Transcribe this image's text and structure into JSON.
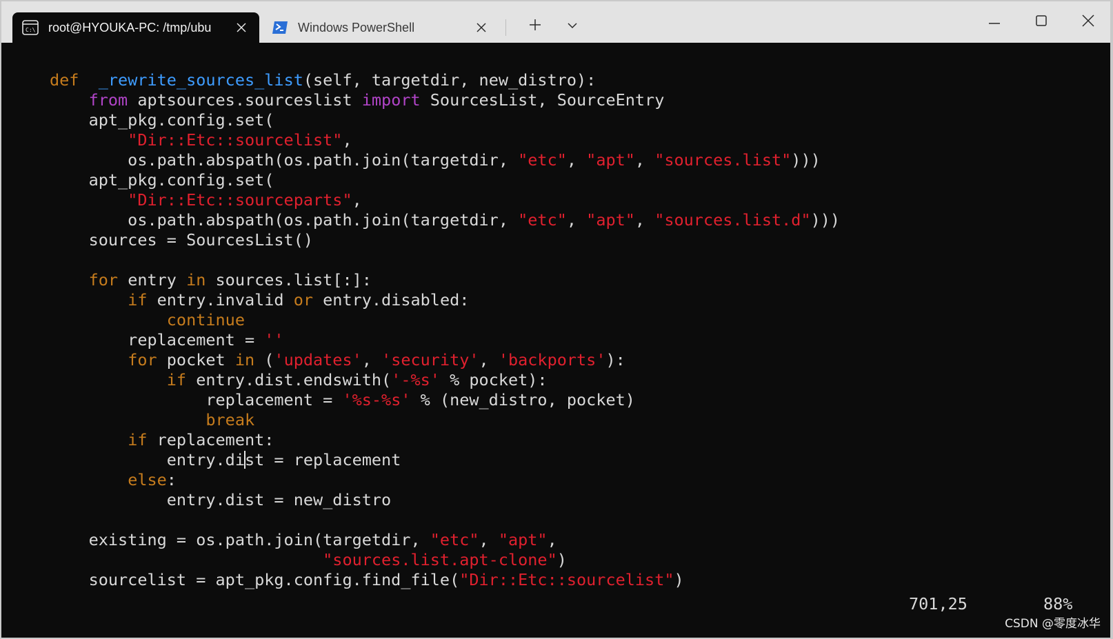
{
  "tabs": [
    {
      "label": "root@HYOUKA-PC: /tmp/ubu",
      "icon": "terminal-icon",
      "active": true
    },
    {
      "label": "Windows PowerShell",
      "icon": "powershell-icon",
      "active": false
    }
  ],
  "toolbar": {
    "new_tab_icon": "plus-icon",
    "dropdown_icon": "chevron-down-icon"
  },
  "window_controls": {
    "minimize": "minimize-icon",
    "maximize": "maximize-icon",
    "close": "close-icon"
  },
  "code_lines": [
    [
      [
        "kw",
        "def"
      ],
      [
        "",
        "  "
      ],
      [
        "fn",
        "_rewrite_sources_list"
      ],
      [
        "",
        "(self, targetdir, new_distro):"
      ]
    ],
    [
      [
        "",
        "    "
      ],
      [
        "mg",
        "from"
      ],
      [
        "",
        " aptsources.sourceslist "
      ],
      [
        "mg",
        "import"
      ],
      [
        "",
        " SourcesList, SourceEntry"
      ]
    ],
    [
      [
        "",
        "    apt_pkg.config.set("
      ]
    ],
    [
      [
        "",
        "        "
      ],
      [
        "st",
        "\"Dir::Etc::sourcelist\""
      ],
      [
        "",
        ","
      ]
    ],
    [
      [
        "",
        "        os.path.abspath(os.path.join(targetdir, "
      ],
      [
        "st",
        "\"etc\""
      ],
      [
        "",
        ", "
      ],
      [
        "st",
        "\"apt\""
      ],
      [
        "",
        ", "
      ],
      [
        "st",
        "\"sources.list\""
      ],
      [
        "",
        ")))"
      ]
    ],
    [
      [
        "",
        "    apt_pkg.config.set("
      ]
    ],
    [
      [
        "",
        "        "
      ],
      [
        "st",
        "\"Dir::Etc::sourceparts\""
      ],
      [
        "",
        ","
      ]
    ],
    [
      [
        "",
        "        os.path.abspath(os.path.join(targetdir, "
      ],
      [
        "st",
        "\"etc\""
      ],
      [
        "",
        ", "
      ],
      [
        "st",
        "\"apt\""
      ],
      [
        "",
        ", "
      ],
      [
        "st",
        "\"sources.list.d\""
      ],
      [
        "",
        ")))"
      ]
    ],
    [
      [
        "",
        "    sources = SourcesList()"
      ]
    ],
    [],
    [
      [
        "",
        "    "
      ],
      [
        "kw",
        "for"
      ],
      [
        "",
        " entry "
      ],
      [
        "kw",
        "in"
      ],
      [
        "",
        " sources.list[:]:"
      ]
    ],
    [
      [
        "",
        "        "
      ],
      [
        "kw",
        "if"
      ],
      [
        "",
        " entry.invalid "
      ],
      [
        "kw",
        "or"
      ],
      [
        "",
        " entry.disabled:"
      ]
    ],
    [
      [
        "",
        "            "
      ],
      [
        "kw",
        "continue"
      ]
    ],
    [
      [
        "",
        "        replacement = "
      ],
      [
        "st",
        "''"
      ]
    ],
    [
      [
        "",
        "        "
      ],
      [
        "kw",
        "for"
      ],
      [
        "",
        " pocket "
      ],
      [
        "kw",
        "in"
      ],
      [
        "",
        " ("
      ],
      [
        "st",
        "'updates'"
      ],
      [
        "",
        ", "
      ],
      [
        "st",
        "'security'"
      ],
      [
        "",
        ", "
      ],
      [
        "st",
        "'backports'"
      ],
      [
        "",
        "):"
      ]
    ],
    [
      [
        "",
        "            "
      ],
      [
        "kw",
        "if"
      ],
      [
        "",
        " entry.dist.endswith("
      ],
      [
        "st",
        "'-%s'"
      ],
      [
        "",
        " % pocket):"
      ]
    ],
    [
      [
        "",
        "                replacement = "
      ],
      [
        "st",
        "'%s-%s'"
      ],
      [
        "",
        " % (new_distro, pocket)"
      ]
    ],
    [
      [
        "",
        "                "
      ],
      [
        "kw",
        "break"
      ]
    ],
    [
      [
        "",
        "        "
      ],
      [
        "kw",
        "if"
      ],
      [
        "",
        " replacement:"
      ]
    ],
    [
      [
        "",
        "            entry.di"
      ],
      [
        "cursor",
        ""
      ],
      [
        "",
        "st = replacement"
      ]
    ],
    [
      [
        "",
        "        "
      ],
      [
        "kw",
        "else"
      ],
      [
        "",
        ":"
      ]
    ],
    [
      [
        "",
        "            entry.dist = new_distro"
      ]
    ],
    [],
    [
      [
        "",
        "    existing = os.path.join(targetdir, "
      ],
      [
        "st",
        "\"etc\""
      ],
      [
        "",
        ", "
      ],
      [
        "st",
        "\"apt\""
      ],
      [
        "",
        ","
      ]
    ],
    [
      [
        "",
        "                            "
      ],
      [
        "st",
        "\"sources.list.apt-clone\""
      ],
      [
        "",
        ")"
      ]
    ],
    [
      [
        "",
        "    sourcelist = apt_pkg.config.find_file("
      ],
      [
        "st",
        "\"Dir::Etc::sourcelist\""
      ],
      [
        "",
        ")"
      ]
    ]
  ],
  "status": {
    "position": "701,25",
    "percent": "88%"
  },
  "watermark": "CSDN @零度冰华"
}
